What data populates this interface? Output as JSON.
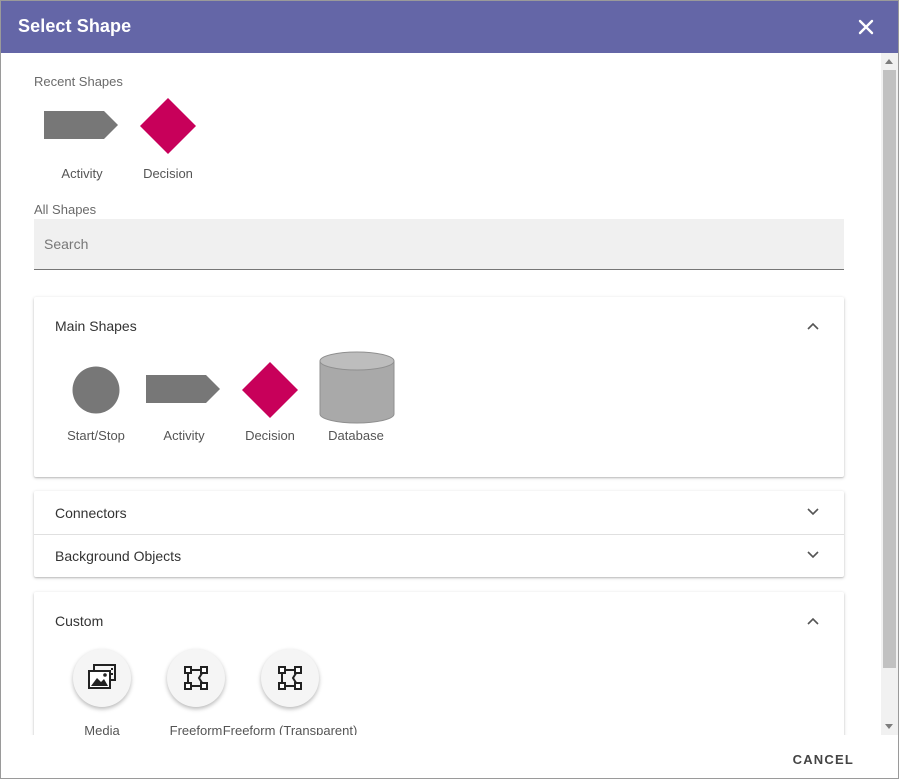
{
  "dialog": {
    "title": "Select Shape",
    "close_icon": "close-icon"
  },
  "recent": {
    "label": "Recent Shapes",
    "items": [
      {
        "label": "Activity",
        "icon": "activity-shape-icon"
      },
      {
        "label": "Decision",
        "icon": "decision-shape-icon"
      }
    ]
  },
  "all": {
    "label": "All Shapes",
    "search_placeholder": "Search"
  },
  "panels": {
    "main": {
      "title": "Main Shapes",
      "expanded": true,
      "items": [
        {
          "label": "Start/Stop",
          "icon": "circle-shape-icon"
        },
        {
          "label": "Activity",
          "icon": "activity-shape-icon"
        },
        {
          "label": "Decision",
          "icon": "decision-shape-icon"
        },
        {
          "label": "Database",
          "icon": "database-shape-icon"
        }
      ]
    },
    "connectors": {
      "title": "Connectors",
      "expanded": false
    },
    "background": {
      "title": "Background Objects",
      "expanded": false
    },
    "custom": {
      "title": "Custom",
      "expanded": true,
      "items": [
        {
          "label": "Media",
          "icon": "media-icon"
        },
        {
          "label": "Freeform",
          "icon": "freeform-icon"
        },
        {
          "label": "Freeform (Transparent)",
          "icon": "freeform-transparent-icon"
        }
      ]
    }
  },
  "footer": {
    "cancel_label": "CANCEL"
  },
  "colors": {
    "header_bg": "#6466a7",
    "shape_gray": "#777777",
    "decision_magenta": "#c8005a",
    "database_gray": "#a9a9a9"
  }
}
